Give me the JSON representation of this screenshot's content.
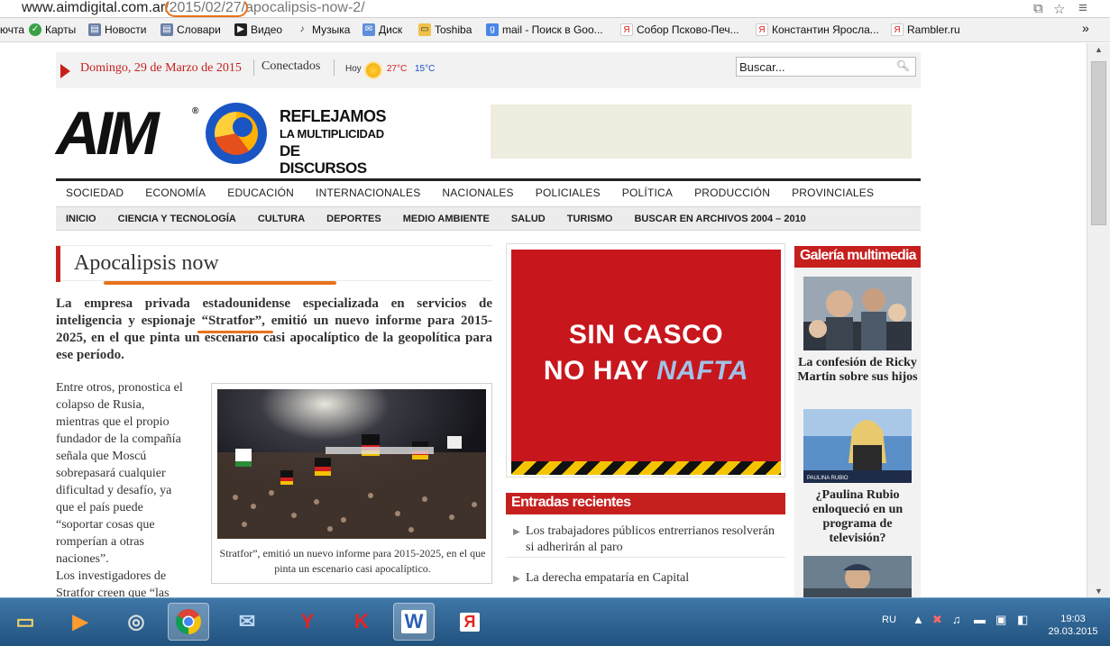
{
  "browser": {
    "url_host": "www.aimdigital.com.ar",
    "url_path": "/2015/02/27/apocalipsis-now-2/"
  },
  "bookmarks": [
    "ючта",
    "Карты",
    "Новости",
    "Словари",
    "Видео",
    "Музыка",
    "Диск",
    "Toshiba",
    "mail - Поиск в Goo...",
    "Собор Псково-Печ...",
    "Константин Яросла...",
    "Rambler.ru"
  ],
  "bookmarks_more": "»",
  "topbar": {
    "date": "Domingo, 29 de Marzo de 2015",
    "status": "Conectados",
    "weather_label": "Hoy",
    "temp_high": "27°C",
    "temp_low": "15°C",
    "search_placeholder": "Buscar..."
  },
  "logo": {
    "text": "AIM",
    "tagline": [
      "REFLEJAMOS",
      "LA MULTIPLICIDAD",
      "DE DISCURSOS"
    ]
  },
  "nav_primary": [
    "SOCIEDAD",
    "ECONOMÍA",
    "EDUCACIÓN",
    "INTERNACIONALES",
    "NACIONALES",
    "POLICIALES",
    "POLÍTICA",
    "PRODUCCIÓN",
    "PROVINCIALES"
  ],
  "nav_secondary": [
    "INICIO",
    "CIENCIA Y TECNOLOGÍA",
    "CULTURA",
    "DEPORTES",
    "MEDIO AMBIENTE",
    "SALUD",
    "TURISMO",
    "BUSCAR EN ARCHIVOS 2004 – 2010"
  ],
  "article": {
    "title": "Apocalipsis now",
    "lead_before": "La empresa privada estadounidense especializada en servicios de inteligencia y espionaje ",
    "lead_highlight": "“Stratfor”",
    "lead_after": ", emitió un nuevo informe para 2015-2025, en el que pinta un escenario casi apocalíptico de la geopolítica para ese período.",
    "body_lines": [
      "Entre otros, pronostica el",
      "colapso de Rusia,",
      "mientras que el propio",
      "fundador de la compañía",
      "señala que Moscú",
      "sobrepasará cualquier",
      "dificultad y desafío, ya",
      "que el país puede",
      "“soportar cosas que",
      "romperían a otras",
      "naciones”.",
      "Los investigadores de",
      "Stratfor creen que “las"
    ],
    "photo_caption": "Stratfor”, emitió un nuevo informe para 2015-2025, en el que pinta un escenario casi apocalíptico."
  },
  "banner": {
    "line1": "SIN CASCO",
    "line2_a": "NO HAY ",
    "line2_b": "NAFTA"
  },
  "recent": {
    "heading": "Entradas recientes",
    "posts": [
      "Los trabajadores públicos entrerrianos resolverán si adherirán al paro",
      "La derecha empataría en Capital"
    ]
  },
  "gallery": {
    "heading": "Galería multimedia",
    "items": [
      "La confesión de Ricky Martin sobre sus hijos",
      "¿Paulina Rubio enloqueció en un programa de televisión?"
    ]
  },
  "taskbar": {
    "lang": "RU",
    "time": "19:03",
    "date": "29.03.2015"
  }
}
